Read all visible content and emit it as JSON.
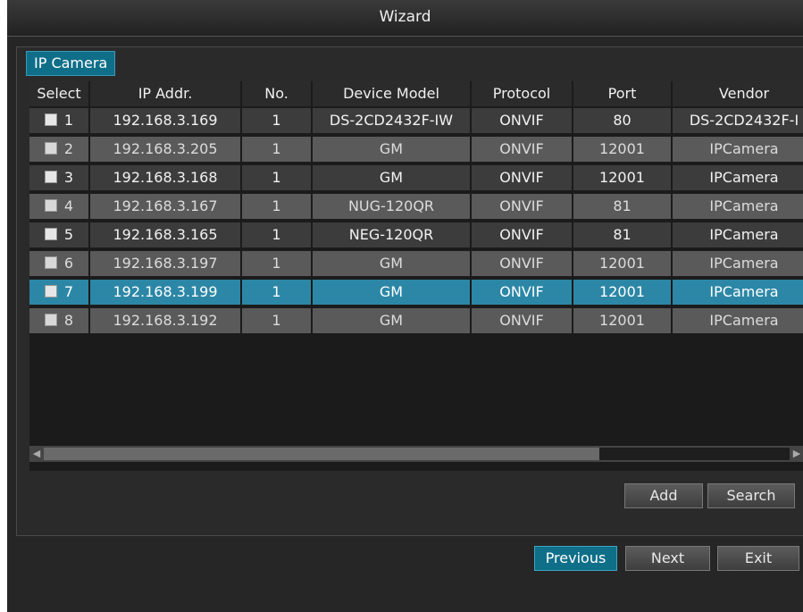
{
  "window": {
    "title": "Wizard"
  },
  "tab": {
    "label": "IP Camera"
  },
  "table": {
    "columns": [
      "Select",
      "IP Addr.",
      "No.",
      "Device Model",
      "Protocol",
      "Port",
      "Vendor"
    ],
    "rows": [
      {
        "num": "1",
        "ip": "192.168.3.169",
        "no": "1",
        "model": "DS-2CD2432F-IW",
        "protocol": "ONVIF",
        "port": "80",
        "vendor": "DS-2CD2432F-I"
      },
      {
        "num": "2",
        "ip": "192.168.3.205",
        "no": "1",
        "model": "GM",
        "protocol": "ONVIF",
        "port": "12001",
        "vendor": "IPCamera"
      },
      {
        "num": "3",
        "ip": "192.168.3.168",
        "no": "1",
        "model": "GM",
        "protocol": "ONVIF",
        "port": "12001",
        "vendor": "IPCamera"
      },
      {
        "num": "4",
        "ip": "192.168.3.167",
        "no": "1",
        "model": "NUG-120QR",
        "protocol": "ONVIF",
        "port": "81",
        "vendor": "IPCamera"
      },
      {
        "num": "5",
        "ip": "192.168.3.165",
        "no": "1",
        "model": "NEG-120QR",
        "protocol": "ONVIF",
        "port": "81",
        "vendor": "IPCamera"
      },
      {
        "num": "6",
        "ip": "192.168.3.197",
        "no": "1",
        "model": "GM",
        "protocol": "ONVIF",
        "port": "12001",
        "vendor": "IPCamera"
      },
      {
        "num": "7",
        "ip": "192.168.3.199",
        "no": "1",
        "model": "GM",
        "protocol": "ONVIF",
        "port": "12001",
        "vendor": "IPCamera"
      },
      {
        "num": "8",
        "ip": "192.168.3.192",
        "no": "1",
        "model": "GM",
        "protocol": "ONVIF",
        "port": "12001",
        "vendor": "IPCamera"
      }
    ],
    "selected_row": "7"
  },
  "buttons": {
    "add": "Add",
    "search": "Search",
    "previous": "Previous",
    "next": "Next",
    "exit": "Exit"
  },
  "icons": {
    "scroll_left": "scroll-left-arrow-icon",
    "scroll_right": "scroll-right-arrow-icon",
    "checkbox": "checkbox-icon"
  },
  "colors": {
    "accent": "#0f6f89",
    "selected_row": "#2c87a6"
  }
}
